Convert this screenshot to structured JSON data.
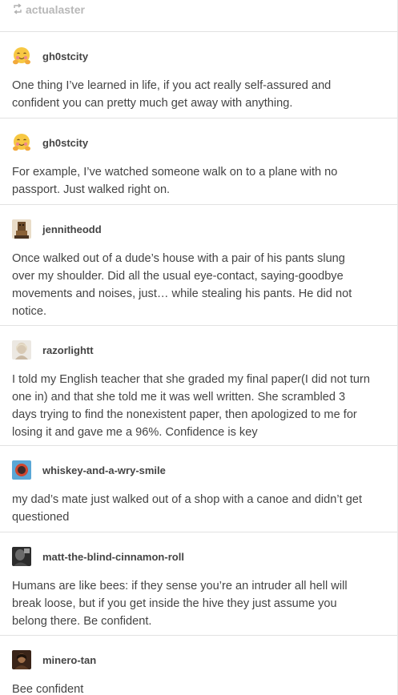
{
  "reblog_header": {
    "icon": "reblog-icon",
    "username": "actualaster"
  },
  "posts": [
    {
      "username": "gh0stcity",
      "avatar": "hugging-face-emoji",
      "lines": [
        "One thing I’ve learned in life, if you act really self-assured and",
        "confident you can pretty much get away with anything."
      ]
    },
    {
      "username": "gh0stcity",
      "avatar": "hugging-face-emoji",
      "lines": [
        "For example, I’ve watched someone walk on to a plane with no",
        "passport. Just walked right on."
      ]
    },
    {
      "username": "jennitheodd",
      "avatar": "character-avatar",
      "lines": [
        "Once walked out of a dude’s house with a pair of his pants slung",
        "over my shoulder. Did all the usual eye-contact, saying-goodbye",
        "movements and noises, just… while stealing his pants. He did not",
        "notice."
      ]
    },
    {
      "username": "razorlightt",
      "avatar": "light-photo-avatar",
      "lines": [
        "I told my English teacher that she graded my final paper(I did not turn",
        "one in) and that she told me it was well written. She scrambled 3",
        "days trying to find the nonexistent paper, then apologized to me for",
        "losing it and gave me a 96%. Confidence is key"
      ]
    },
    {
      "username": "whiskey-and-a-wry-smile",
      "avatar": "blue-circle-avatar",
      "lines": [
        "my dad’s mate just walked out of a shop with a canoe and didn’t get",
        "questioned"
      ]
    },
    {
      "username": "matt-the-blind-cinnamon-roll",
      "avatar": "dark-photo-avatar",
      "lines": [
        "Humans are like bees: if they sense you’re an intruder all hell will",
        "break loose, but if you get inside the hive they just assume you",
        "belong there. Be confident."
      ]
    },
    {
      "username": "minero-tan",
      "avatar": "dark-portrait-avatar",
      "lines": [
        "Bee confident"
      ]
    }
  ]
}
